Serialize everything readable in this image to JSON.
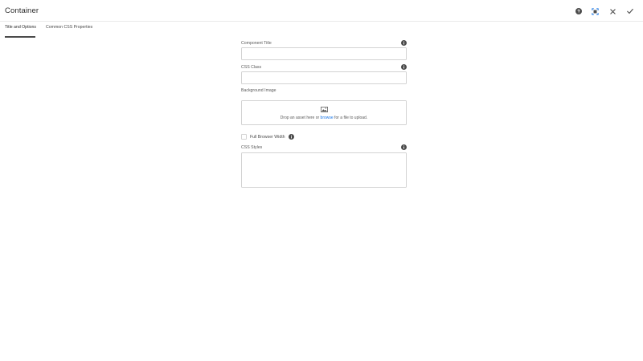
{
  "dialog": {
    "title": "Container",
    "actions": {
      "help_icon": "help-icon",
      "fullscreen_icon": "fullscreen-icon",
      "close_icon": "close-icon",
      "done_icon": "check-icon"
    },
    "colors": {
      "accent": "#1473e6",
      "border": "#d3d3d3",
      "icon_dark": "#4b4b4b"
    }
  },
  "tabs": [
    {
      "label": "Title and Options",
      "active": true
    },
    {
      "label": "Common CSS Properties",
      "active": false
    }
  ],
  "form": {
    "component_title": {
      "label": "Component Title",
      "value": ""
    },
    "css_class": {
      "label": "CSS Class",
      "value": ""
    },
    "background_image": {
      "label": "Background Image",
      "drop_prefix": "Drop an asset here or ",
      "browse_link": "browse",
      "drop_suffix": " for a file to upload."
    },
    "full_browser_width": {
      "label": "Full Browser Width",
      "checked": false
    },
    "css_styles": {
      "label": "CSS Styles",
      "value": ""
    }
  }
}
